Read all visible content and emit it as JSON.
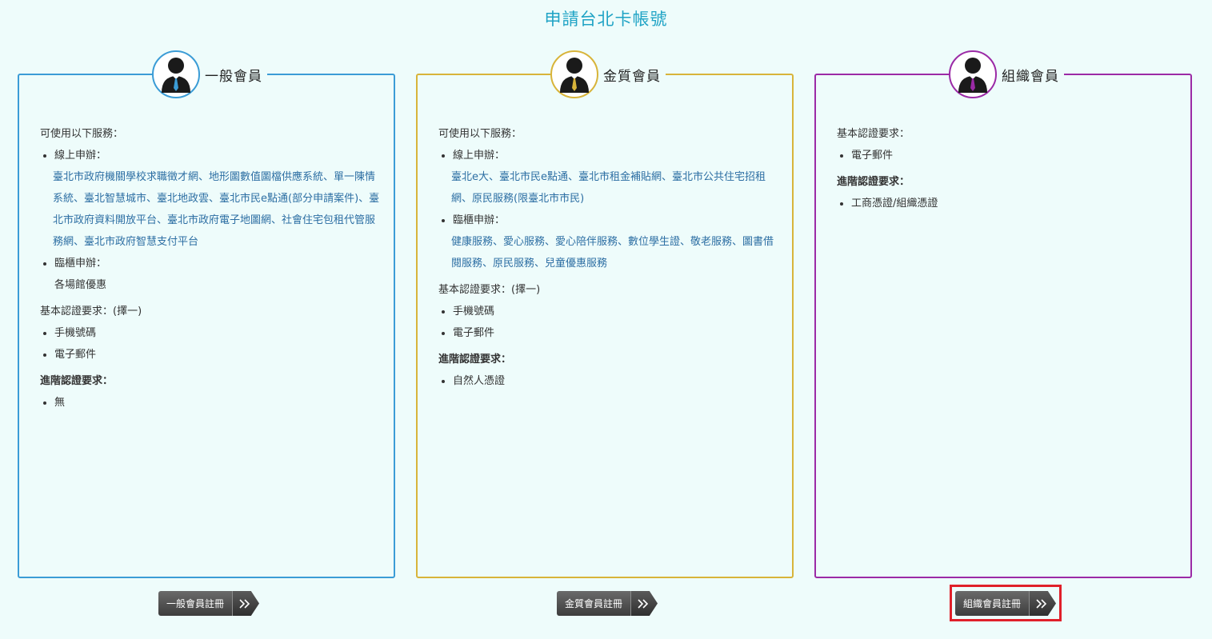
{
  "title": "申請台北卡帳號",
  "cards": {
    "general": {
      "name": "一般會員",
      "services_heading": "可使用以下服務：",
      "online_label": "線上申辦：",
      "online_links": "臺北市政府機關學校求職徵才網、地形圖數值圖檔供應系統、單一陳情系統、臺北智慧城市、臺北地政雲、臺北市民e點通(部分申請案件)、臺北市政府資料開放平台、臺北市政府電子地圖網、社會住宅包租代管服務網、臺北市政府智慧支付平台",
      "counter_label": "臨櫃申辦：",
      "counter_value": "各場館優惠",
      "basic_heading": "基本認證要求：(擇一)",
      "basic_items": [
        "手機號碼",
        "電子郵件"
      ],
      "advanced_heading": "進階認證要求：",
      "advanced_items": [
        "無"
      ],
      "button": "一般會員註冊"
    },
    "gold": {
      "name": "金質會員",
      "services_heading": "可使用以下服務：",
      "online_label": "線上申辦：",
      "online_links": "臺北e大、臺北市民e點通、臺北市租金補貼網、臺北市公共住宅招租網、原民服務(限臺北市市民)",
      "counter_label": "臨櫃申辦：",
      "counter_links": "健康服務、愛心服務、愛心陪伴服務、數位學生證、敬老服務、圖書借閱服務、原民服務、兒童優惠服務",
      "basic_heading": "基本認證要求：(擇一)",
      "basic_items": [
        "手機號碼",
        "電子郵件"
      ],
      "advanced_heading": "進階認證要求：",
      "advanced_items": [
        "自然人憑證"
      ],
      "button": "金質會員註冊"
    },
    "org": {
      "name": "組織會員",
      "basic_heading": "基本認證要求：",
      "basic_items": [
        "電子郵件"
      ],
      "advanced_heading": "進階認證要求：",
      "advanced_items": [
        "工商憑證/組織憑證"
      ],
      "button": "組織會員註冊"
    }
  },
  "colors": {
    "general": "#3b9cd6",
    "gold": "#d8b43a",
    "org": "#9b2aa6",
    "highlight": "#e0202a"
  }
}
